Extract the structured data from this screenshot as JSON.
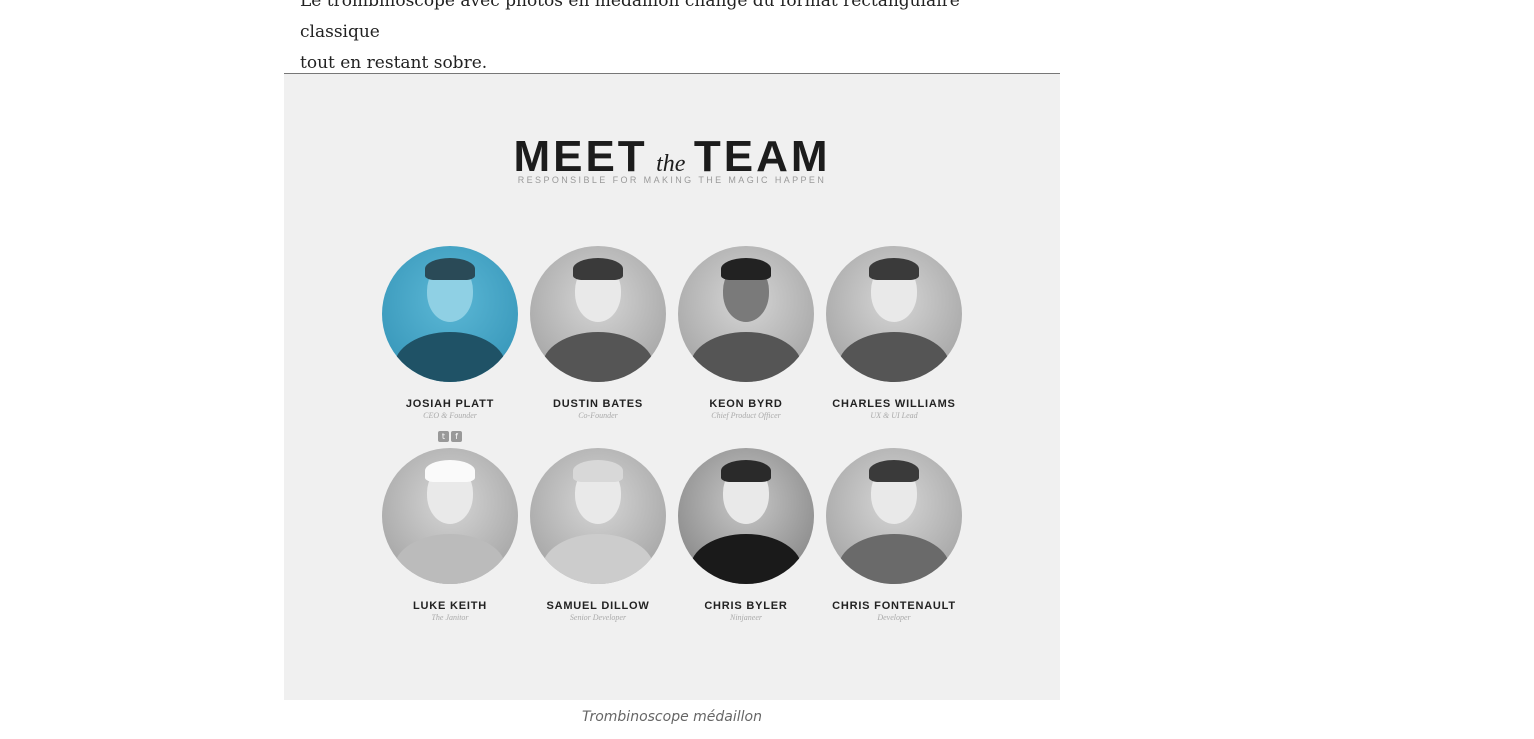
{
  "article": {
    "intro_line1": "Le trombinoscope avec photos en médaillon change du format rectangulaire classique",
    "intro_line2": "tout en restant sobre."
  },
  "figure": {
    "title_meet": "MEET",
    "title_the": "the",
    "title_team": "TEAM",
    "tagline": "RESPONSIBLE FOR MAKING THE MAGIC HAPPEN",
    "caption": "Trombinoscope médaillon",
    "accent_color": "#3a9fc4",
    "members": [
      {
        "name": "JOSIAH PLATT",
        "role": "CEO & Founder"
      },
      {
        "name": "DUSTIN BATES",
        "role": "Co-Founder"
      },
      {
        "name": "KEON BYRD",
        "role": "Chief Product Officer"
      },
      {
        "name": "CHARLES WILLIAMS",
        "role": "UX & UI Lead"
      },
      {
        "name": "LUKE KEITH",
        "role": "The Janitor"
      },
      {
        "name": "SAMUEL DILLOW",
        "role": "Senior Developer"
      },
      {
        "name": "CHRIS BYLER",
        "role": "Ninjaneer"
      },
      {
        "name": "CHRIS FONTENAULT",
        "role": "Developer"
      }
    ],
    "social_icons": [
      "twitter-icon",
      "facebook-icon"
    ]
  }
}
